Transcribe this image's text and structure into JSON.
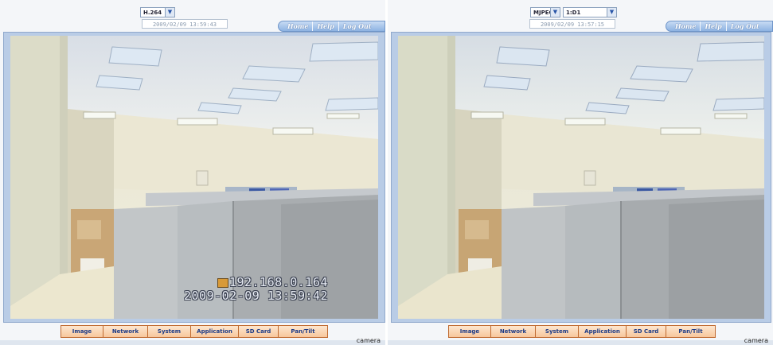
{
  "left_view": {
    "codec_select": {
      "value": "H.264"
    },
    "timestamp": "2009/02/09 13:59:43",
    "top_nav": [
      "Home",
      "Help",
      "Log Out"
    ],
    "video_overlay": {
      "ip": "192.168.0.164",
      "datetime": "2009-02-09  13:59:42"
    },
    "tabs": [
      "Image",
      "Network",
      "System",
      "Application",
      "SD Card",
      "Pan/Tilt"
    ],
    "footer_label": "camera"
  },
  "right_view": {
    "codec_select": {
      "value": "MJPEG"
    },
    "resolution_select": {
      "value": "1:D1"
    },
    "timestamp": "2009/02/09 13:57:15",
    "top_nav": [
      "Home",
      "Help",
      "Log Out"
    ],
    "tabs": [
      "Image",
      "Network",
      "System",
      "Application",
      "SD Card",
      "Pan/Tilt"
    ],
    "footer_label": "camera"
  },
  "colors": {
    "frame_border": "#b9cce6",
    "tab_fill": "#fcd9b8",
    "tab_text": "#1b3a86",
    "nav_fill": "#8eb3e2"
  },
  "icons": [
    "chevron-down-icon",
    "overlay-record-icon"
  ]
}
